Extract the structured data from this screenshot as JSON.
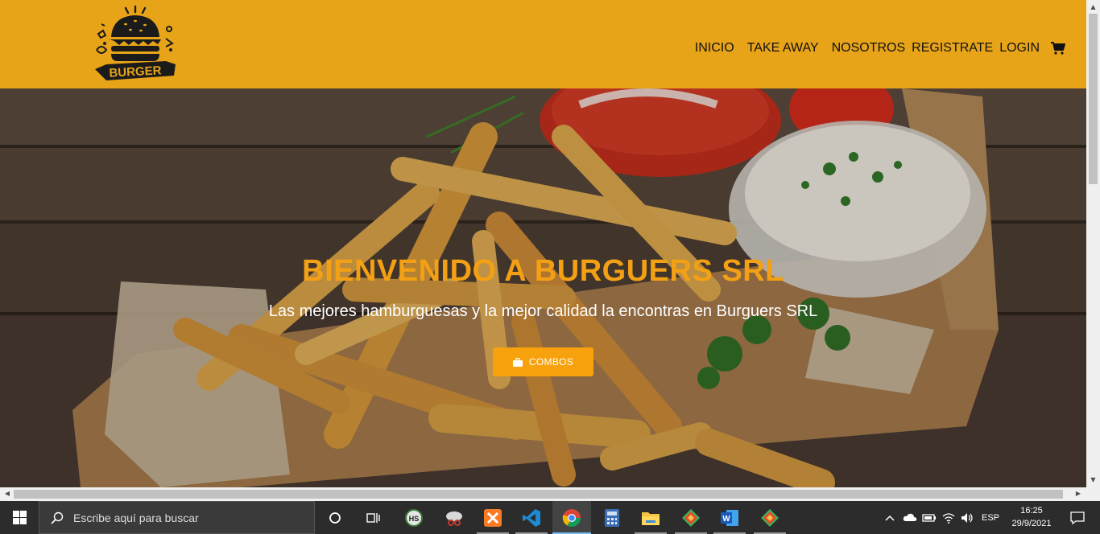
{
  "navbar": {
    "logo_text": "BURGER",
    "links": [
      "INICIO",
      "TAKE AWAY",
      "NOSOTROS",
      "REGISTRATE",
      "LOGIN"
    ],
    "cart_icon": "cart-icon",
    "background": "#e8a419"
  },
  "hero": {
    "title": "BIENVENIDO A BURGUERS SRL",
    "subtitle": "Las mejores hamburguesas y la mejor calidad la encontras en Burguers SRL",
    "button_label": "COMBOS",
    "button_icon": "bag-icon",
    "title_color": "#f4a014",
    "button_color": "#f7a20c"
  },
  "taskbar": {
    "search_placeholder": "Escribe aquí para buscar",
    "language": "ESP",
    "time": "16:25",
    "date": "29/9/2021",
    "apps": [
      "task-view-icon",
      "hubspot-icon",
      "snipping-icon",
      "xampp-icon",
      "vscode-icon",
      "chrome-icon",
      "calculator-icon",
      "file-explorer-icon",
      "git-icon",
      "word-icon",
      "git-icon"
    ]
  }
}
